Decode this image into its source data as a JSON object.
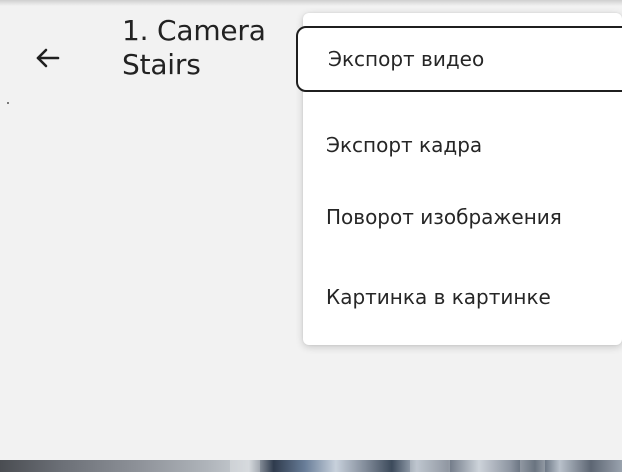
{
  "header": {
    "title_line1": "1. Camera",
    "title_line2": "Stairs",
    "back_icon": "arrow-left-icon"
  },
  "context_menu": {
    "items": [
      {
        "label": "Экспорт видео",
        "focused": true
      },
      {
        "label": "Экспорт кадра",
        "focused": false
      },
      {
        "label": "Поворот изображения",
        "focused": false
      },
      {
        "label": "Картинка в картинке",
        "focused": false
      }
    ]
  },
  "colors": {
    "background": "#f2f2f2",
    "menu_background": "#ffffff",
    "focus_outline": "#1f1f1f",
    "text": "#262626"
  }
}
